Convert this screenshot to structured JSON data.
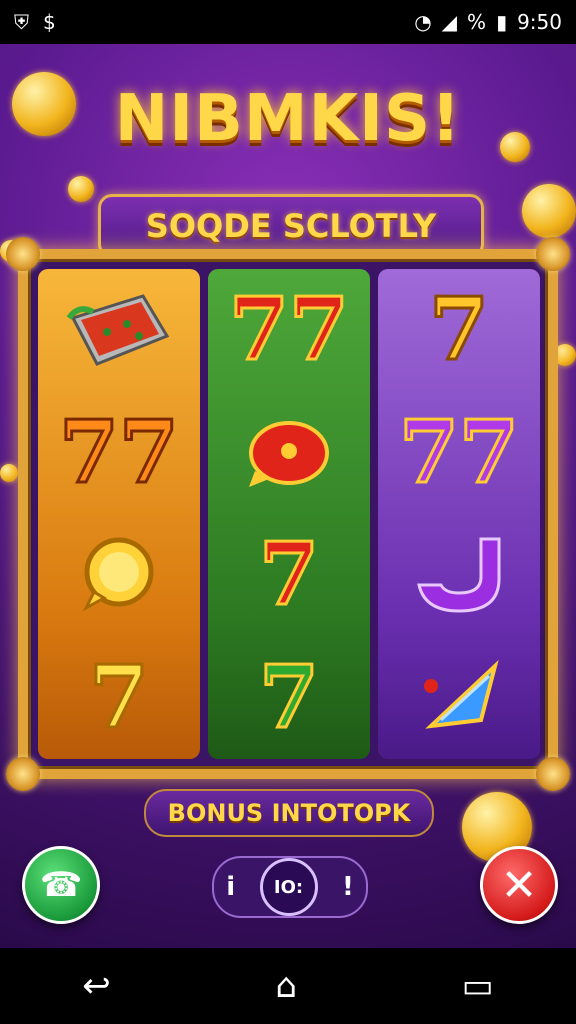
{
  "status_bar": {
    "time": "9:50",
    "left_icons": [
      "shield-icon",
      "dollar-icon"
    ],
    "battery_text": "%"
  },
  "game": {
    "title": "NIBMKIS!",
    "subtitle": "SOQDE SCLOTLY",
    "reels": [
      {
        "symbols": [
          "watermelon-slice",
          "7",
          "coin",
          "7"
        ],
        "colors": [
          "#d9381e",
          "#ff8a1a",
          "#ffd23a",
          "#ffe04a"
        ]
      },
      {
        "symbols": [
          "7",
          "cherry",
          "7",
          "7"
        ],
        "colors": [
          "#e0241a",
          "#e0241a",
          "#e0241a",
          "#2ea82e"
        ]
      },
      {
        "symbols": [
          "7",
          "7",
          "j-shape",
          "gem"
        ],
        "colors": [
          "#ffc52a",
          "#b03ae8",
          "#9a2ee0",
          "#3a9aff"
        ]
      }
    ],
    "bonus_label": "BONUS INTOTOPK"
  },
  "controls": {
    "call_icon": "phone-icon",
    "close_icon": "close-icon",
    "left_glyph": "i",
    "center_glyph": "IO:",
    "right_glyph": "!"
  },
  "nav": {
    "back": "↩",
    "home": "⌂",
    "recents": "▭"
  }
}
